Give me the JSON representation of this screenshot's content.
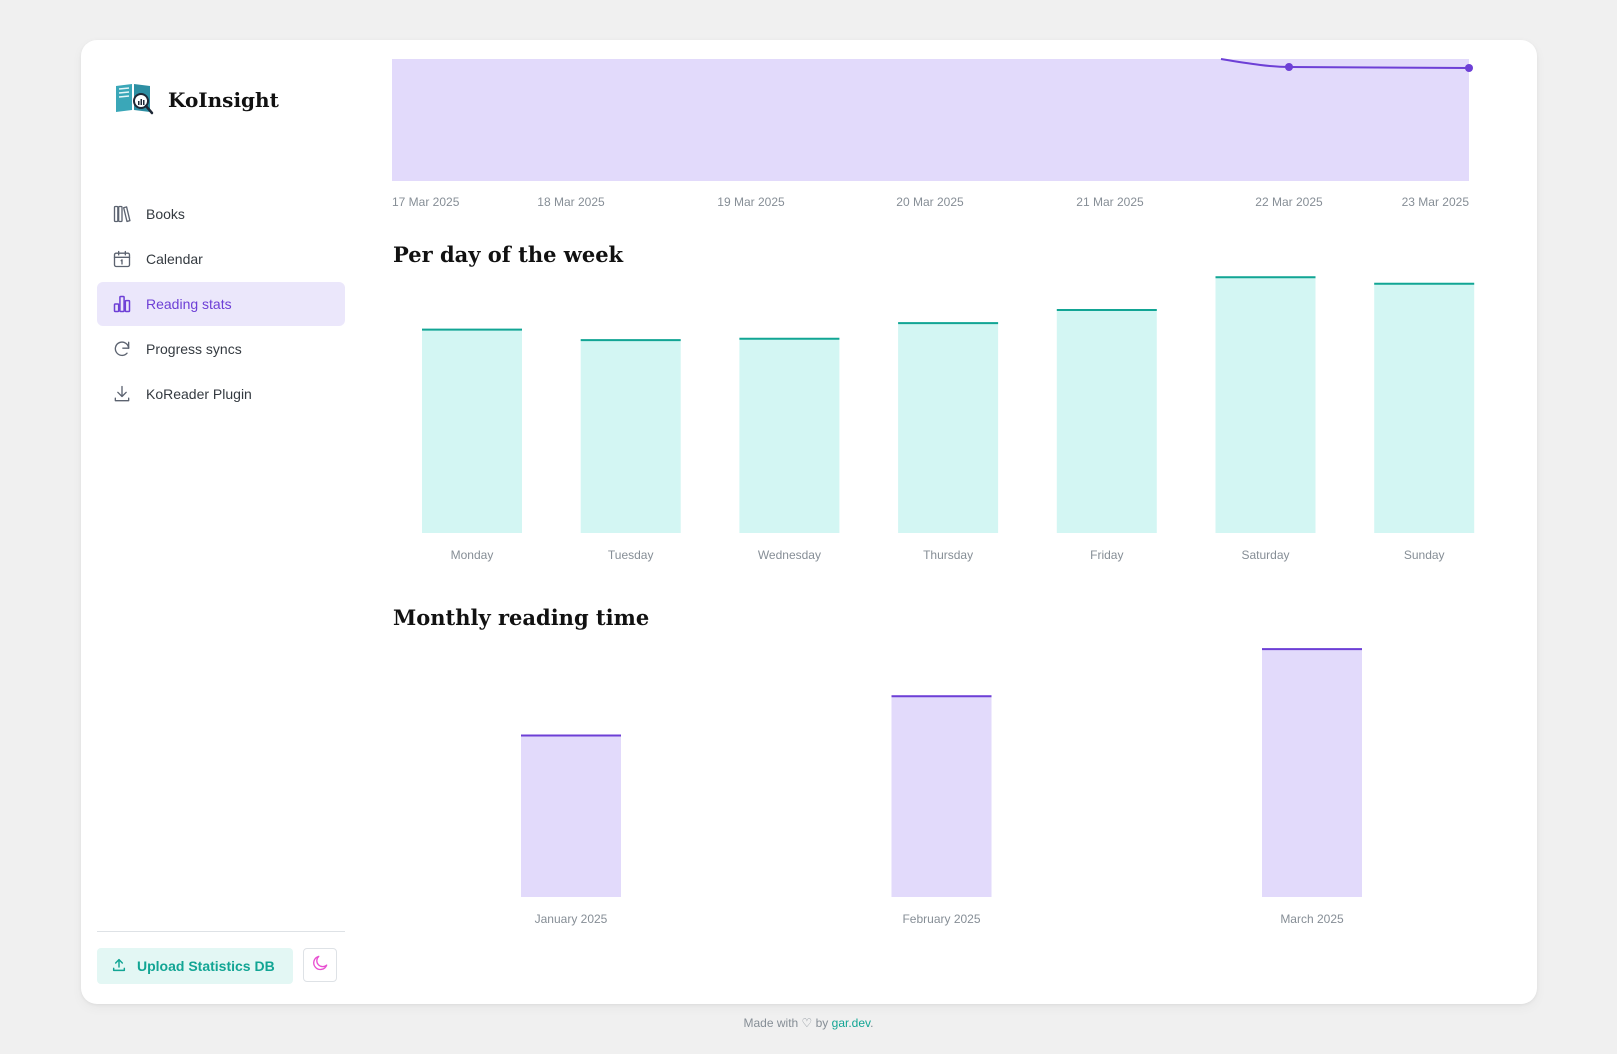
{
  "app": {
    "title": "KoInsight"
  },
  "sidebar": {
    "items": [
      {
        "label": "Books",
        "icon": "books-icon",
        "active": false
      },
      {
        "label": "Calendar",
        "icon": "calendar-icon",
        "active": false
      },
      {
        "label": "Reading stats",
        "icon": "bar-chart-icon",
        "active": true
      },
      {
        "label": "Progress syncs",
        "icon": "refresh-icon",
        "active": false
      },
      {
        "label": "KoReader Plugin",
        "icon": "download-icon",
        "active": false
      }
    ],
    "upload_label": "Upload Statistics DB",
    "theme_toggle_icon": "moon-icon"
  },
  "colors": {
    "accent": "#6d3fd6",
    "teal": "#12a594",
    "teal_fill": "#d3f6f3",
    "purple_fill": "#e2dafb",
    "active_bg": "#ebe7fb"
  },
  "sections": {
    "per_day": "Per day of the week",
    "monthly": "Monthly reading time"
  },
  "chart_data": [
    {
      "type": "area",
      "x": [
        "17 Mar 2025",
        "18 Mar 2025",
        "19 Mar 2025",
        "20 Mar 2025",
        "21 Mar 2025",
        "22 Mar 2025",
        "23 Mar 2025"
      ],
      "note_visible": "top of chart is cropped; line only visible near 22–23 Mar",
      "title": "",
      "xlabel": "",
      "ylabel": ""
    },
    {
      "type": "bar",
      "title": "Per day of the week",
      "categories": [
        "Monday",
        "Tuesday",
        "Wednesday",
        "Thursday",
        "Friday",
        "Saturday",
        "Sunday"
      ],
      "values": [
        78,
        74,
        74.5,
        80.5,
        85.5,
        98,
        95.5
      ],
      "ylim": [
        0,
        100
      ]
    },
    {
      "type": "bar",
      "title": "Monthly reading time",
      "categories": [
        "January 2025",
        "February 2025",
        "March 2025"
      ],
      "values": [
        62,
        77,
        95
      ],
      "ylim": [
        0,
        100
      ]
    }
  ],
  "footer": {
    "prefix": "Made with ♡ by ",
    "link": "gar.dev",
    "suffix": "."
  }
}
